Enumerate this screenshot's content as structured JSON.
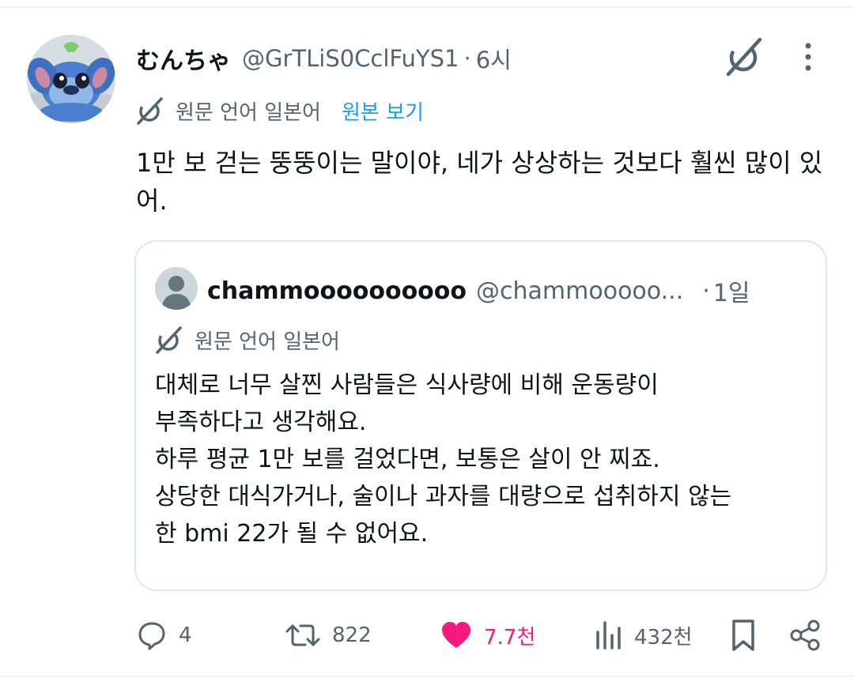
{
  "tweet": {
    "display_name": "むんちゃ",
    "handle": "@GrTLiS0CclFuYS1",
    "separator": "·",
    "time": "6시",
    "translation": {
      "label": "원문 언어 일본어",
      "link": "원본 보기"
    },
    "text": "1만 보 걷는 뚱뚱이는 말이야, 네가 상상하는 것보다 훨씬 많이 있어."
  },
  "quote": {
    "display_name": "chammoooooooooo",
    "handle": "@chammooooo...",
    "separator": "·",
    "time": "1일",
    "translation_label": "원문 언어 일본어",
    "lines": [
      "대체로 너무 살찐 사람들은 식사량에 비해 운동량이",
      "부족하다고 생각해요.",
      "하루 평균 1만 보를 걸었다면, 보통은 살이 안 찌죠.",
      "상당한 대식가거나, 술이나 과자를 대량으로 섭취하지 않는",
      "한 bmi 22가 될 수 없어요."
    ]
  },
  "actions": {
    "replies": "4",
    "reposts": "822",
    "likes": "7.7천",
    "views": "432천"
  },
  "icons": {
    "reply": "reply-bubble-icon",
    "repost": "repost-arrows-icon",
    "like": "heart-filled-icon",
    "views": "views-bar-chart-icon",
    "bookmark": "bookmark-icon",
    "share": "share-icon",
    "grok": "grok-icon",
    "more": "more-vertical-icon",
    "translate": "translate-icon"
  },
  "colors": {
    "text": "#0f1419",
    "secondary": "#536471",
    "link": "#1d9bf0",
    "like": "#f91880",
    "border": "#e1e8ed"
  }
}
